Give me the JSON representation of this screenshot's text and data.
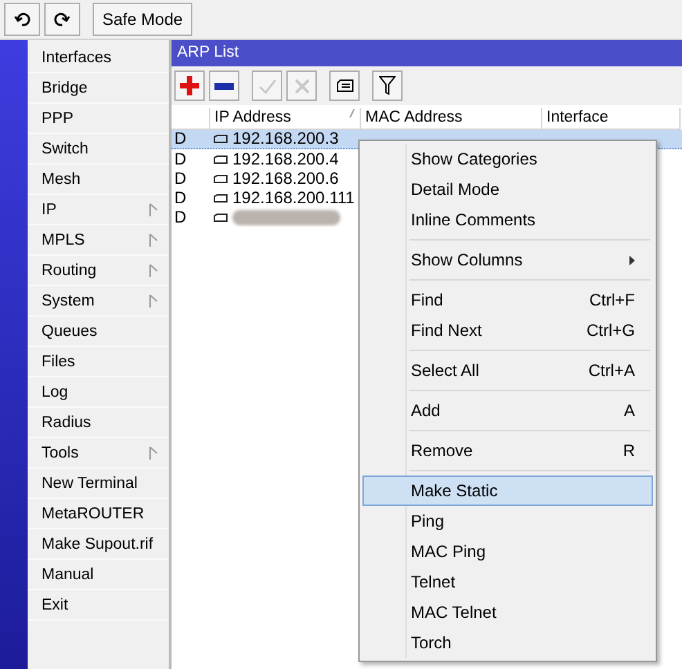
{
  "toolbar": {
    "buttons": [
      {
        "kind": "undo"
      },
      {
        "kind": "redo"
      }
    ],
    "safe_mode": "Safe Mode"
  },
  "sidebar": {
    "items": [
      {
        "label": "Interfaces",
        "submenu": false
      },
      {
        "label": "Bridge",
        "submenu": false
      },
      {
        "label": "PPP",
        "submenu": false
      },
      {
        "label": "Switch",
        "submenu": false
      },
      {
        "label": "Mesh",
        "submenu": false
      },
      {
        "label": "IP",
        "submenu": true
      },
      {
        "label": "MPLS",
        "submenu": true
      },
      {
        "label": "Routing",
        "submenu": true
      },
      {
        "label": "System",
        "submenu": true
      },
      {
        "label": "Queues",
        "submenu": false
      },
      {
        "label": "Files",
        "submenu": false
      },
      {
        "label": "Log",
        "submenu": false
      },
      {
        "label": "Radius",
        "submenu": false
      },
      {
        "label": "Tools",
        "submenu": true
      },
      {
        "label": "New Terminal",
        "submenu": false
      },
      {
        "label": "MetaROUTER",
        "submenu": false
      },
      {
        "label": "Make Supout.rif",
        "submenu": false
      },
      {
        "label": "Manual",
        "submenu": false
      },
      {
        "label": "Exit",
        "submenu": false
      }
    ]
  },
  "window": {
    "title": "ARP List",
    "tools": [
      {
        "kind": "add",
        "disabled": false
      },
      {
        "kind": "remove",
        "disabled": false
      },
      {
        "kind": "enable",
        "disabled": true
      },
      {
        "kind": "disable",
        "disabled": true
      },
      {
        "kind": "comment",
        "disabled": false
      },
      {
        "kind": "filter",
        "disabled": false
      }
    ],
    "table": {
      "columns": [
        "IP Address",
        "MAC Address",
        "Interface"
      ],
      "rows": [
        {
          "flag": "D",
          "ip": "192.168.200.3",
          "selected": true,
          "redacted": false
        },
        {
          "flag": "D",
          "ip": "192.168.200.4",
          "selected": false,
          "redacted": false
        },
        {
          "flag": "D",
          "ip": "192.168.200.6",
          "selected": false,
          "redacted": false
        },
        {
          "flag": "D",
          "ip": "192.168.200.111",
          "selected": false,
          "redacted": false
        },
        {
          "flag": "D",
          "selected": false,
          "redacted": true
        }
      ]
    }
  },
  "context_menu": {
    "groups": [
      [
        {
          "label": "Show Categories",
          "selected": false
        },
        {
          "label": "Detail Mode",
          "selected": false
        },
        {
          "label": "Inline Comments",
          "selected": false
        }
      ],
      [
        {
          "label": "Show Columns",
          "submenu": true,
          "selected": false
        }
      ],
      [
        {
          "label": "Find",
          "shortcut": "Ctrl+F",
          "selected": false
        },
        {
          "label": "Find Next",
          "shortcut": "Ctrl+G",
          "selected": false
        }
      ],
      [
        {
          "label": "Select All",
          "shortcut": "Ctrl+A",
          "selected": false
        }
      ],
      [
        {
          "label": "Add",
          "shortcut": "A",
          "selected": false
        }
      ],
      [
        {
          "label": "Remove",
          "shortcut": "R",
          "selected": false
        }
      ],
      [
        {
          "label": "Make Static",
          "selected": true
        },
        {
          "label": "Ping",
          "selected": false
        },
        {
          "label": "MAC Ping",
          "selected": false
        },
        {
          "label": "Telnet",
          "selected": false
        },
        {
          "label": "MAC Telnet",
          "selected": false
        },
        {
          "label": "Torch",
          "selected": false
        }
      ]
    ]
  }
}
